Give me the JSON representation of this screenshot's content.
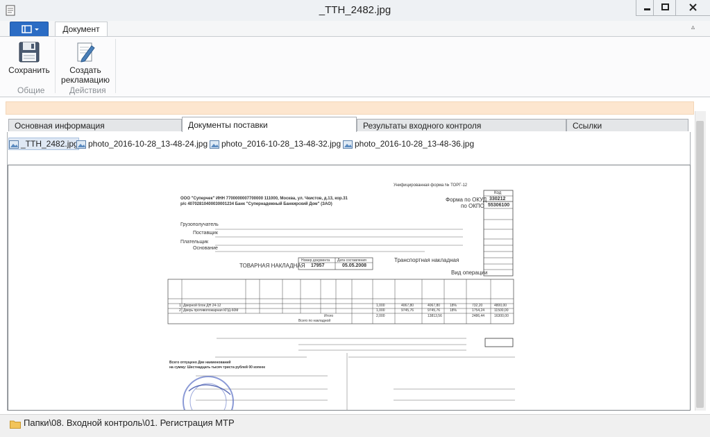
{
  "window": {
    "title": "_TTH_2482.jpg"
  },
  "ribbon": {
    "tab_label": "Документ",
    "buttons": {
      "save": "Сохранить",
      "create_claim_line1": "Создать",
      "create_claim_line2": "рекламацию"
    },
    "groups": {
      "general": "Общие",
      "actions": "Действия"
    }
  },
  "panel_tabs": [
    "Основная информация",
    "Документы поставки",
    "Результаты входного контроля",
    "Ссылки"
  ],
  "files": [
    "_TTH_2482.jpg",
    "photo_2016-10-28_13-48-24.jpg",
    "photo_2016-10-28_13-48-32.jpg",
    "photo_2016-10-28_13-48-36.jpg"
  ],
  "document": {
    "org_line1": "ООО \"Суперчек\" ИНН 7700000007700000 111000, Москва, ул. Чкистов, д.13, кор.31",
    "org_line2": "р/с 40702810400030001234 Банк \"Супернадежный Банкирский Дом\" (ЗАО)",
    "form_okud_label": "Форма по ОКУД",
    "form_okud": "330212",
    "okpo_label": "по ОКПО",
    "okpo": "55306100",
    "code_header": "Код",
    "doc_title": "ТОВАРНАЯ НАКЛАДНАЯ",
    "doc_number_label": "Номер документа",
    "doc_date_label": "Дата составления",
    "doc_number": "17957",
    "doc_date": "05.05.2008",
    "consignee_label": "Грузополучатель",
    "supplier_label": "Поставщик",
    "payer_label": "Плательщик",
    "basis_label": "Основание",
    "transport_label": "Транспортная накладная",
    "op_kind_label": "Вид операции",
    "items": [
      {
        "n": "1",
        "name": "Дверной блок ДН 24-12",
        "qty": "1,000",
        "price": "4067,80",
        "sum": "4067,80",
        "vat": "18%",
        "vat_sum": "732,20",
        "total": "4800,00"
      },
      {
        "n": "2",
        "name": "Дверь противопожарная КПД-60М",
        "qty": "1,000",
        "price": "9745,76",
        "sum": "9745,76",
        "vat": "18%",
        "vat_sum": "1754,24",
        "total": "11500,00"
      }
    ],
    "total_label": "Итого",
    "total_qty": "2,000",
    "total_sum": "13813,56",
    "total_vat": "2486,44",
    "total_all": "16300,00",
    "grand_label": "Всего по накладной",
    "footer_text": "Всего отпущено Две наименований",
    "footer_sum": "на сумму: Шестнадцать тысяч триста рублей 00 копеек"
  },
  "status": {
    "path": "Папки\\08. Входной контроль\\01. Регистрация МТР"
  },
  "colors": {
    "accent": "#2b6cc4",
    "notice": "#fde6cf"
  }
}
